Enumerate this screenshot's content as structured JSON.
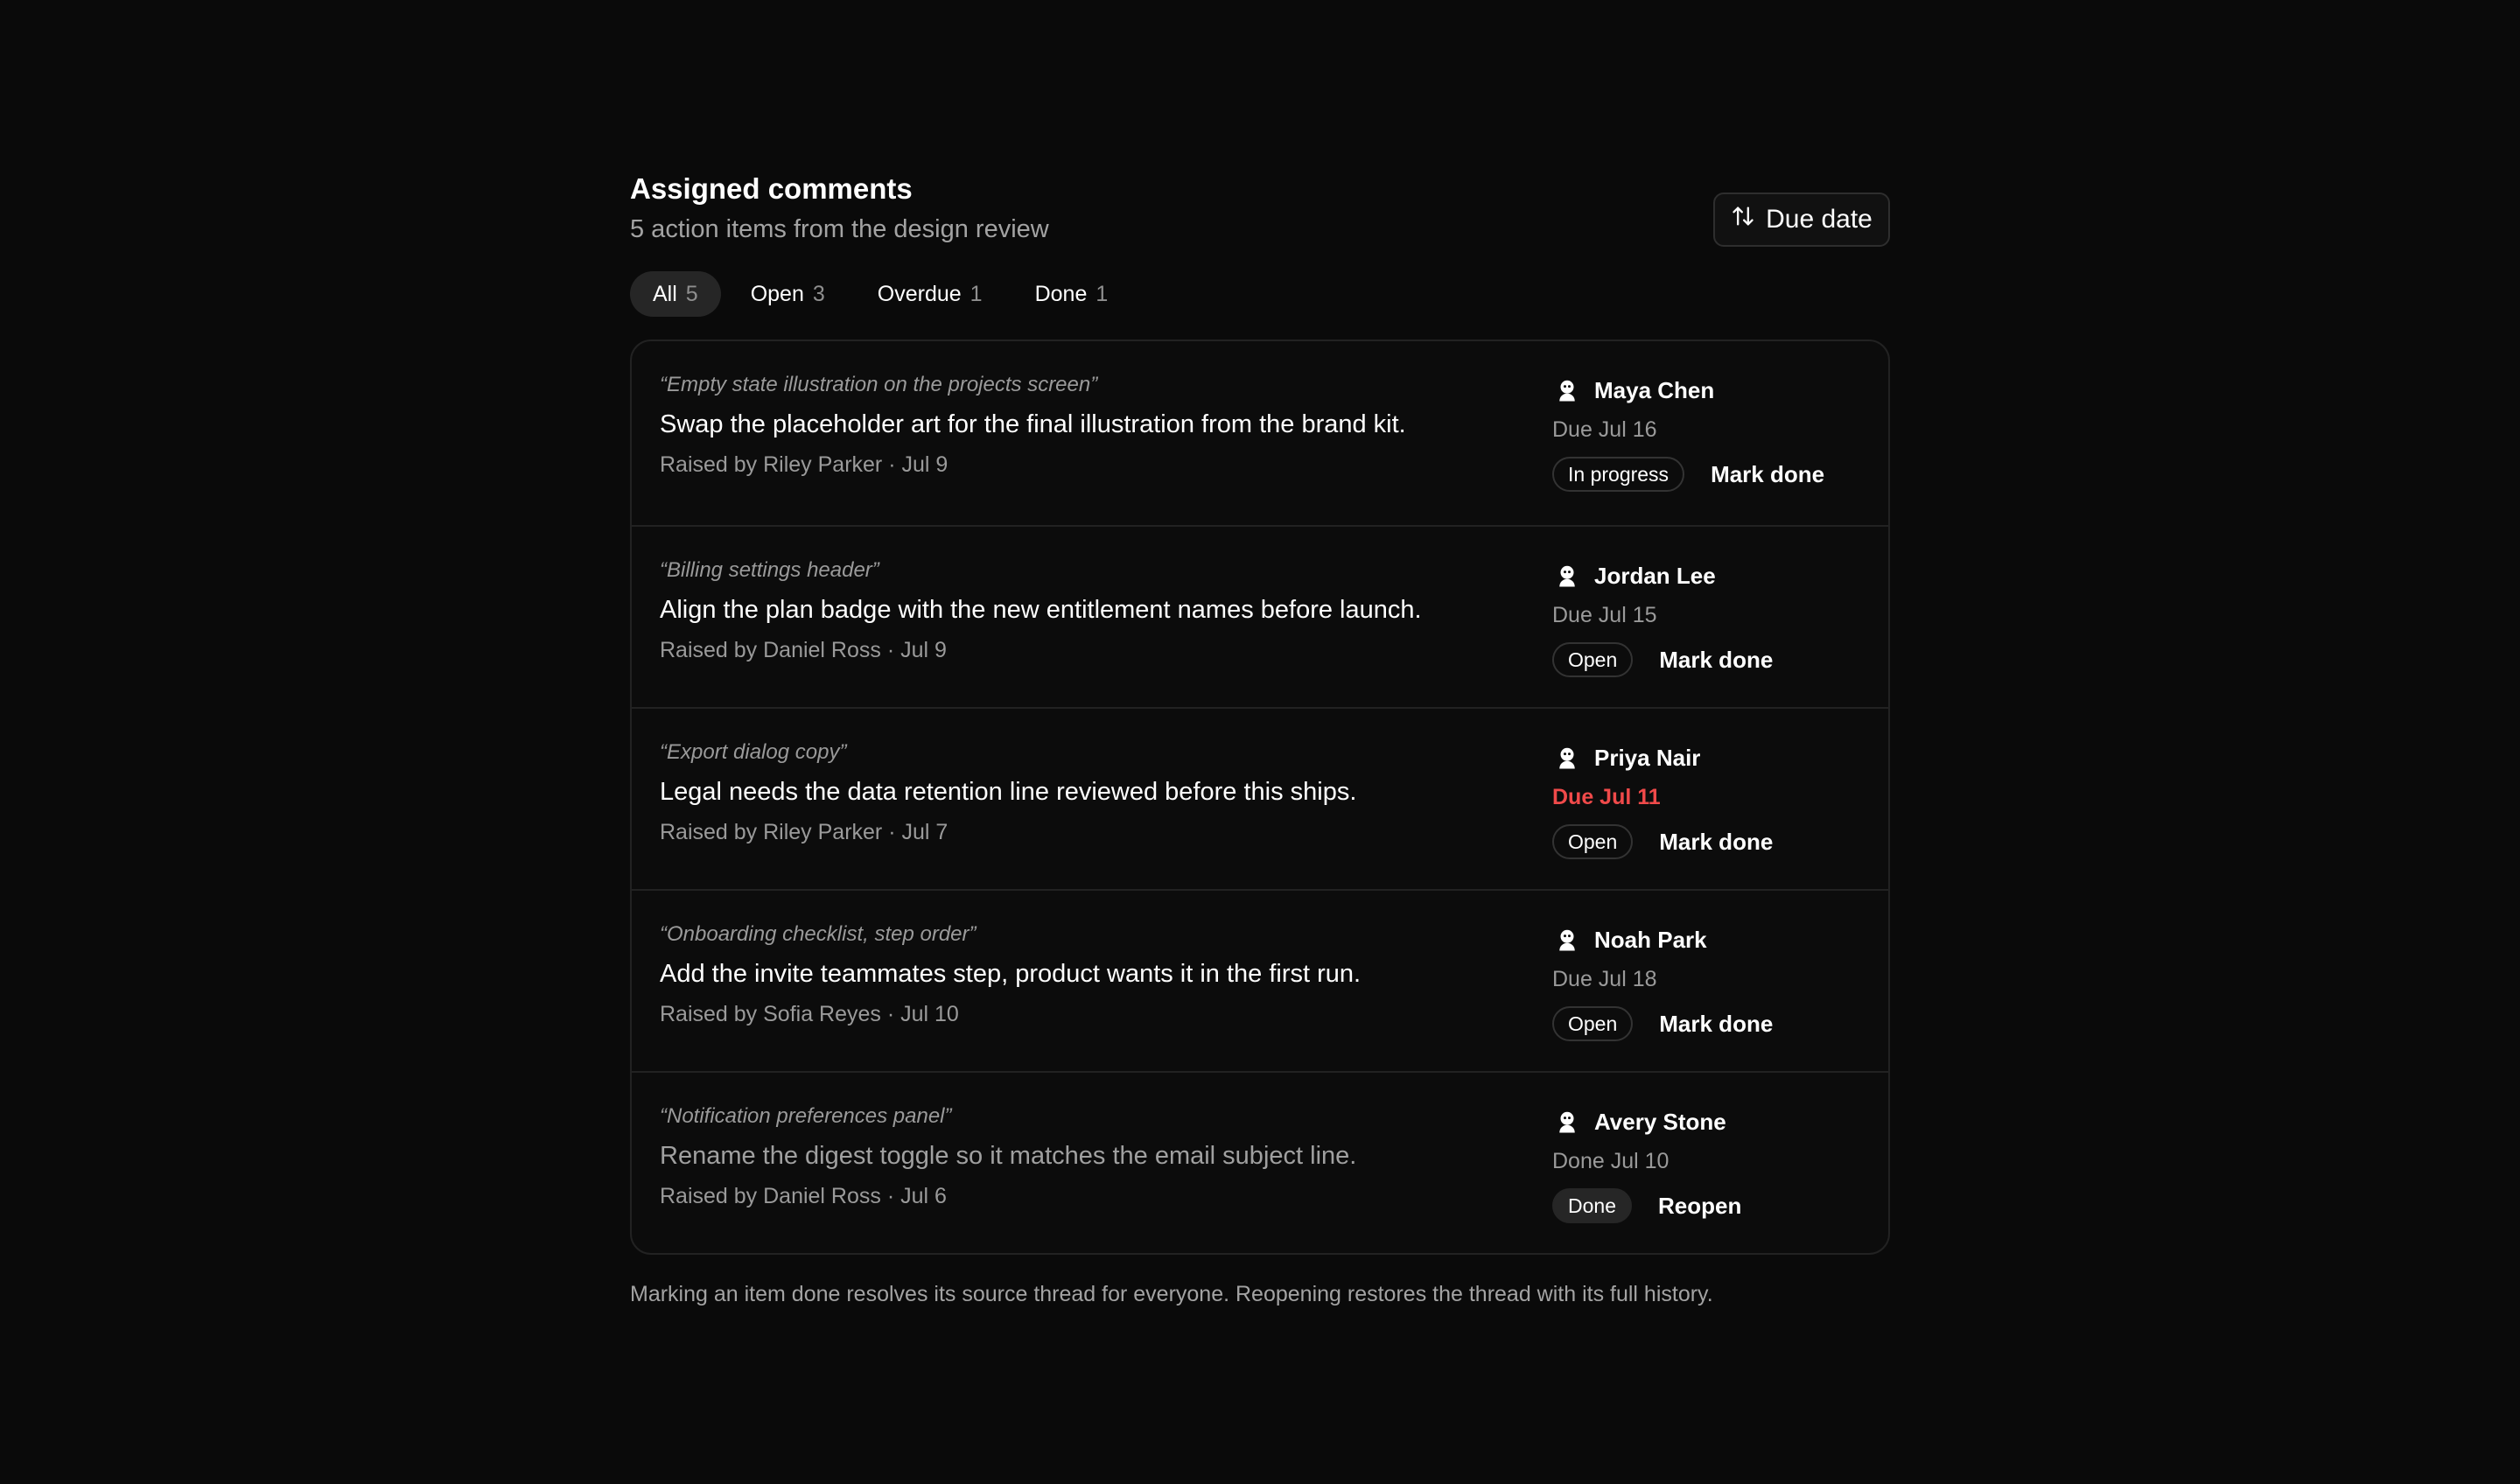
{
  "header": {
    "title": "Assigned comments",
    "subtitle": "5 action items from the design review",
    "sort_label": "Due date",
    "sort_icon": "sort-arrows-icon"
  },
  "filters": [
    {
      "label": "All",
      "count": "5",
      "active": true
    },
    {
      "label": "Open",
      "count": "3",
      "active": false
    },
    {
      "label": "Overdue",
      "count": "1",
      "active": false
    },
    {
      "label": "Done",
      "count": "1",
      "active": false
    }
  ],
  "items": [
    {
      "quote": "“Empty state illustration on the projects screen”",
      "text": "Swap the placeholder art for the final illustration from the brand kit.",
      "raised": "Raised by Riley Parker · Jul 9",
      "assignee": "Maya Chen",
      "due": "Due Jul 16",
      "status": "In progress",
      "action": "Mark done"
    },
    {
      "quote": "“Billing settings header”",
      "text": "Align the plan badge with the new entitlement names before launch.",
      "raised": "Raised by Daniel Ross · Jul 9",
      "assignee": "Jordan Lee",
      "due": "Due Jul 15",
      "status": "Open",
      "action": "Mark done"
    },
    {
      "quote": "“Export dialog copy”",
      "text": "Legal needs the data retention line reviewed before this ships.",
      "raised": "Raised by Riley Parker · Jul 7",
      "assignee": "Priya Nair",
      "due": "Due Jul 11",
      "status": "Open",
      "action": "Mark done"
    },
    {
      "quote": "“Onboarding checklist, step order”",
      "text": "Add the invite teammates step, product wants it in the first run.",
      "raised": "Raised by Sofia Reyes · Jul 10",
      "assignee": "Noah Park",
      "due": "Due Jul 18",
      "status": "Open",
      "action": "Mark done"
    },
    {
      "quote": "“Notification preferences panel”",
      "text": "Rename the digest toggle so it matches the email subject line.",
      "raised": "Raised by Daniel Ross · Jul 6",
      "assignee": "Avery Stone",
      "due": "Done Jul 10",
      "status": "Done",
      "action": "Reopen"
    }
  ],
  "footnote": "Marking an item done resolves its source thread for everyone. Reopening restores the thread with its full history.",
  "colors": {
    "background": "#0a0a0a",
    "overdue": "#f04a4a",
    "muted": "#9a9a9a"
  }
}
